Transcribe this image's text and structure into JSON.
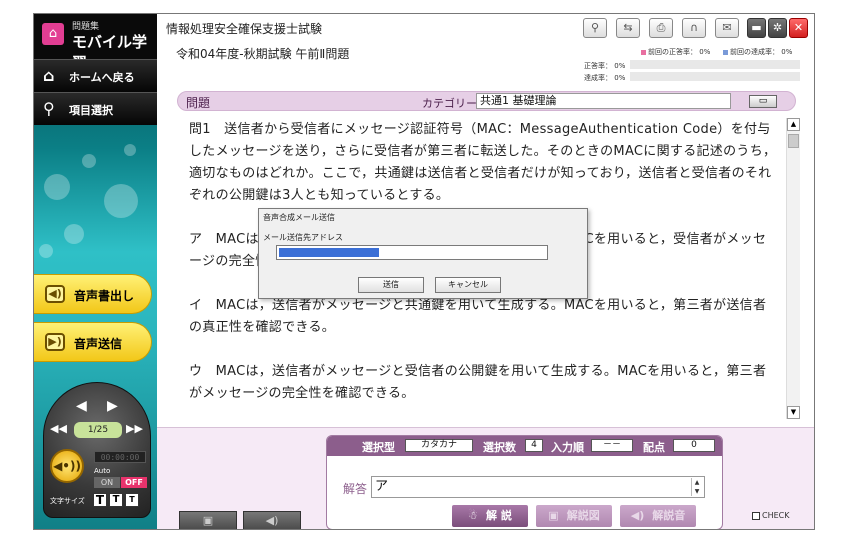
{
  "app": {
    "logo_small": "問題集",
    "logo_main": "モバイル学習",
    "title": "情報処理安全確保支援士試験",
    "subtitle": "令和04年度-秋期試験 午前Ⅱ問題"
  },
  "sidebar": {
    "home_label": "ホームへ戻る",
    "select_label": "項目選択",
    "voice_read_label": "音声書出し",
    "voice_send_label": "音声送信",
    "voice_icon_text": "◀•))",
    "page_indicator": "1/25",
    "counter_text": "00:00:00",
    "auto_label": "Auto",
    "on_label": "ON",
    "off_label": "OFF",
    "font_size_label": "文字サイズ",
    "font_sizes": [
      "T",
      "T",
      "T"
    ]
  },
  "stats": {
    "prev_correct_label": "前回の正答率：",
    "prev_correct_value": "0%",
    "prev_achieve_label": "前回の達成率：",
    "prev_achieve_value": "0%",
    "correct_label": "正答率：",
    "correct_value": "0%",
    "achieve_label": "達成率：",
    "achieve_value": "0%",
    "correct_fraction": 0,
    "achieve_fraction": 0,
    "colors": {
      "correct": "#e86fa0",
      "achieve": "#7a9ad8"
    }
  },
  "question": {
    "header": "問題",
    "category_label": "カテゴリー",
    "category_value": "共通1 基礎理論",
    "paragraphs": [
      "問1　送信者から受信者にメッセージ認証符号（MAC：MessageAuthentication Code）を付与したメッセージを送り，さらに受信者が第三者に転送した。そのときのMACに関する記述のうち，適切なものはどれか。ここで，共通鍵は送信者と受信者だけが知っており，送信者と受信者のそれぞれの公開鍵は3人とも知っているとする。",
      "ア　MACは，送信者がメッセージと共通鍵を用いて生成する。MACを用いると，受信者がメッセージの完全性を確認できる。",
      "イ　MACは，送信者がメッセージと共通鍵を用いて生成する。MACを用いると，第三者が送信者の真正性を確認できる。",
      "ウ　MACは，送信者がメッセージと受信者の公開鍵を用いて生成する。MACを用いると，第三者がメッセージの完全性を確認できる。"
    ]
  },
  "dialog": {
    "title": "音声合成メール送信",
    "address_label": "メール送信先アドレス",
    "send_label": "送信",
    "cancel_label": "キャンセル"
  },
  "answer": {
    "select_type_label": "選択型",
    "select_type_value": "カタカナ",
    "select_count_label": "選択数",
    "select_count_value": "4",
    "input_order_label": "入力順",
    "input_order_value": "－－",
    "points_label": "配点",
    "points_value": "0",
    "answer_label": "解答",
    "answer_value": "ア",
    "explain_label": "解 説",
    "explain_fig_label": "解説図",
    "explain_voice_label": "解説音"
  },
  "check_label": "CHECK"
}
